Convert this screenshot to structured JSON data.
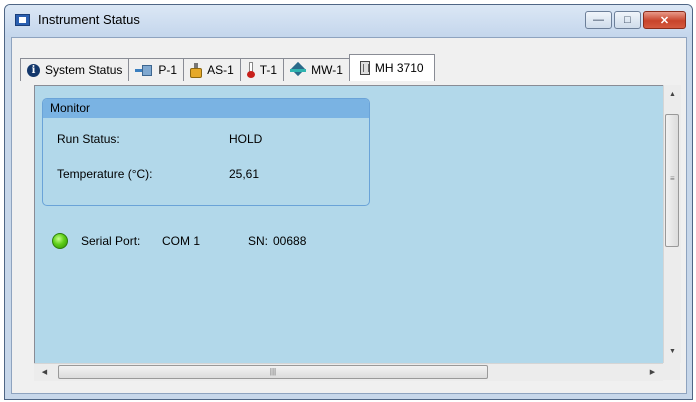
{
  "window": {
    "title": "Instrument Status",
    "minimize_glyph": "—",
    "maximize_glyph": "□",
    "close_glyph": "✕"
  },
  "tabs": [
    {
      "label": "System Status",
      "icon": "info-icon"
    },
    {
      "label": "P-1",
      "icon": "pump-icon"
    },
    {
      "label": "AS-1",
      "icon": "autosampler-icon"
    },
    {
      "label": "T-1",
      "icon": "thermometer-icon"
    },
    {
      "label": "MW-1",
      "icon": "microwave-icon"
    },
    {
      "label": "MH 3710",
      "icon": "module-icon",
      "active": true
    }
  ],
  "monitor": {
    "title": "Monitor",
    "run_status_label": "Run Status:",
    "run_status_value": "HOLD",
    "temperature_label": "Temperature  (°C):",
    "temperature_value": "25,61"
  },
  "connection": {
    "status_color": "#5fcf1a",
    "serial_port_label": "Serial Port:",
    "serial_port_value": "COM 1",
    "sn_label": "SN:",
    "sn_value": "00688"
  },
  "scrollbars": {
    "hthumb_glyph": "|||",
    "vgrip_glyph": "≡",
    "up_arrow": "▲",
    "down_arrow": "▼",
    "left_arrow": "◀",
    "right_arrow": "▶"
  },
  "colors": {
    "panel_bg": "#b2d8ea",
    "monitor_header": "#7ab3e3"
  }
}
